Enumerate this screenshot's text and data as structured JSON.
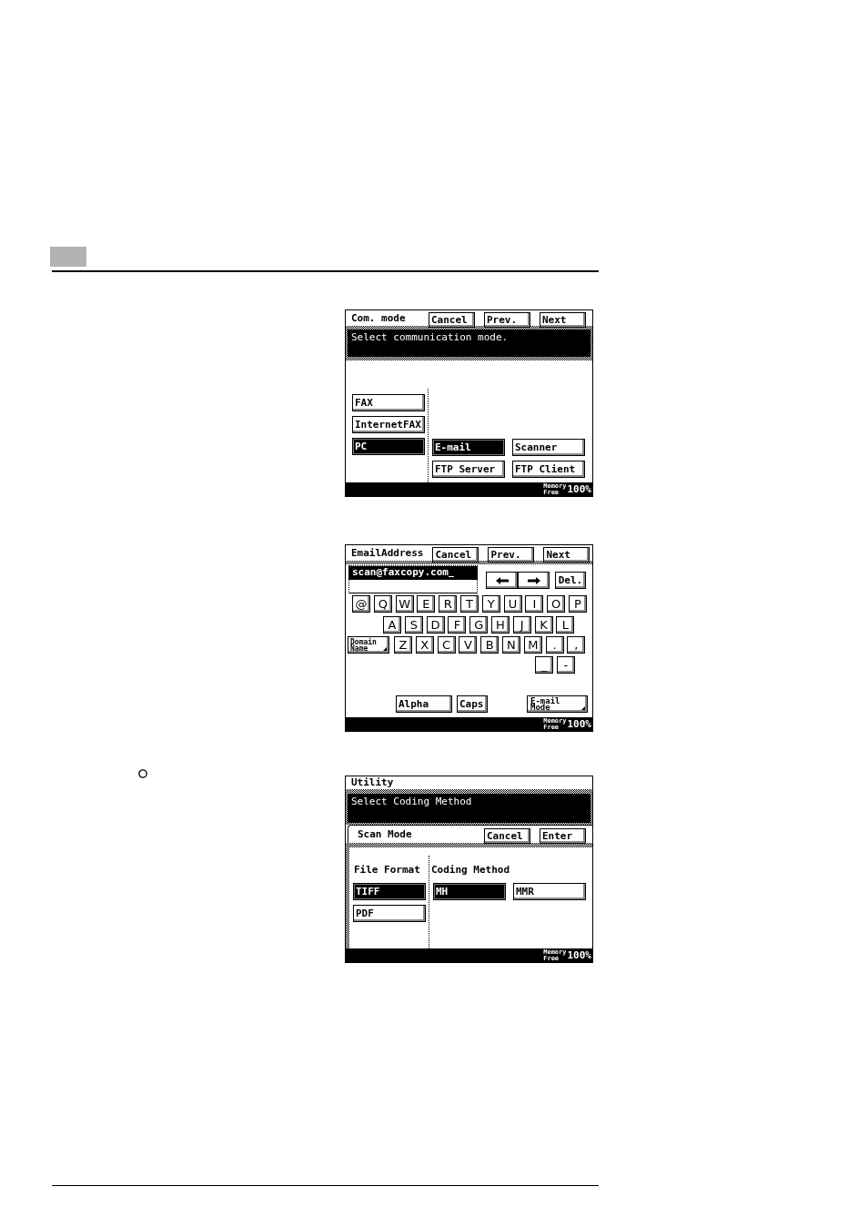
{
  "screens": [
    {
      "kind": "mode_select",
      "title": "Com. mode",
      "nav_buttons": [
        "Cancel",
        "Prev.",
        "Next"
      ],
      "message": "Select communication mode.",
      "left_column": {
        "options": [
          {
            "label": "FAX",
            "selected": false
          },
          {
            "label": "InternetFAX",
            "selected": false
          },
          {
            "label": "PC",
            "selected": true
          }
        ]
      },
      "right_column": {
        "options": [
          {
            "label": "E-mail",
            "selected": true
          },
          {
            "label": "Scanner",
            "selected": false
          },
          {
            "label": "FTP Server",
            "selected": false
          },
          {
            "label": "FTP Client",
            "selected": false
          }
        ]
      },
      "status": {
        "label": "Memory Free",
        "value": "100%"
      }
    },
    {
      "kind": "keyboard",
      "title": "EmailAddress",
      "nav_buttons": [
        "Cancel",
        "Prev.",
        "Next"
      ],
      "address": "scan@faxcopy.com",
      "delete_key": "Del.",
      "key_rows": [
        {
          "keys": [
            {
              "label": "@",
              "kind": "char"
            },
            {
              "label": "Q",
              "kind": "char"
            },
            {
              "label": "W",
              "kind": "char"
            },
            {
              "label": "E",
              "kind": "char"
            },
            {
              "label": "R",
              "kind": "char"
            },
            {
              "label": "T",
              "kind": "char"
            },
            {
              "label": "Y",
              "kind": "char"
            },
            {
              "label": "U",
              "kind": "char"
            },
            {
              "label": "I",
              "kind": "char"
            },
            {
              "label": "O",
              "kind": "char"
            },
            {
              "label": "P",
              "kind": "char"
            }
          ]
        },
        {
          "keys": [
            {
              "label": "A",
              "kind": "char"
            },
            {
              "label": "S",
              "kind": "char"
            },
            {
              "label": "D",
              "kind": "char"
            },
            {
              "label": "F",
              "kind": "char"
            },
            {
              "label": "G",
              "kind": "char"
            },
            {
              "label": "H",
              "kind": "char"
            },
            {
              "label": "J",
              "kind": "char"
            },
            {
              "label": "K",
              "kind": "char"
            },
            {
              "label": "L",
              "kind": "char"
            }
          ]
        },
        {
          "keys": [
            {
              "label": "Domain Name",
              "kind": "menu"
            },
            {
              "label": "Z",
              "kind": "char"
            },
            {
              "label": "X",
              "kind": "char"
            },
            {
              "label": "C",
              "kind": "char"
            },
            {
              "label": "V",
              "kind": "char"
            },
            {
              "label": "B",
              "kind": "char"
            },
            {
              "label": "N",
              "kind": "char"
            },
            {
              "label": "M",
              "kind": "char"
            },
            {
              "label": ".",
              "kind": "char"
            },
            {
              "label": ",",
              "kind": "char"
            }
          ]
        },
        {
          "keys": [
            {
              "label": "_",
              "kind": "char"
            },
            {
              "label": "-",
              "kind": "char"
            }
          ]
        }
      ],
      "mode_buttons": [
        {
          "label": "Alpha",
          "kind": "plain"
        },
        {
          "label": "Caps",
          "kind": "plain"
        },
        {
          "label": "E-mail Mode",
          "kind": "menu"
        }
      ],
      "status": {
        "label": "Memory Free",
        "value": "100%"
      }
    },
    {
      "kind": "setting_select",
      "bullet": true,
      "title": "Utility",
      "message": "Select Coding Method",
      "sub_bar": {
        "title": "Scan Mode",
        "buttons": [
          "Cancel",
          "Enter"
        ]
      },
      "left_column": {
        "heading": "File Format",
        "options": [
          {
            "label": "TIFF",
            "selected": true
          },
          {
            "label": "PDF",
            "selected": false
          }
        ]
      },
      "right_column": {
        "heading": "Coding Method",
        "options": [
          {
            "label": "MH",
            "selected": true
          },
          {
            "label": "MMR",
            "selected": false
          }
        ]
      },
      "status": {
        "label": "Memory Free",
        "value": "100%"
      }
    }
  ]
}
